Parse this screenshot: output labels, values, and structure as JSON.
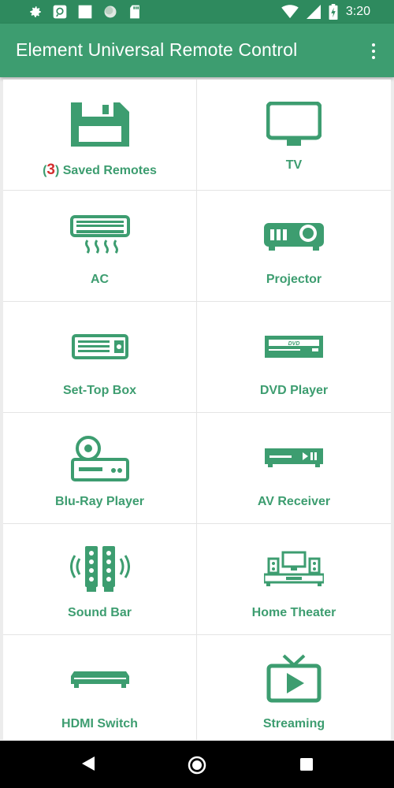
{
  "status_bar": {
    "time": "3:20",
    "left_icons": [
      "gear-icon",
      "cast-icon",
      "square-icon",
      "circle-icon",
      "sd-card-icon"
    ],
    "right_icons": [
      "wifi-icon",
      "signal-icon",
      "battery-icon"
    ]
  },
  "app_bar": {
    "title": "Element Universal Remote Control",
    "menu_icon": "overflow-menu-icon"
  },
  "tiles": [
    {
      "label": "Saved Remotes",
      "count": "3",
      "icon": "floppy-disk-icon"
    },
    {
      "label": "TV",
      "icon": "tv-icon"
    },
    {
      "label": "AC",
      "icon": "air-conditioner-icon"
    },
    {
      "label": "Projector",
      "icon": "projector-icon"
    },
    {
      "label": "Set-Top Box",
      "icon": "set-top-box-icon"
    },
    {
      "label": "DVD Player",
      "icon": "dvd-player-icon",
      "icon_text": "DVD"
    },
    {
      "label": "Blu-Ray Player",
      "icon": "bluray-player-icon"
    },
    {
      "label": "AV Receiver",
      "icon": "av-receiver-icon"
    },
    {
      "label": "Sound Bar",
      "icon": "sound-bar-icon"
    },
    {
      "label": "Home Theater",
      "icon": "home-theater-icon"
    },
    {
      "label": "HDMI Switch",
      "icon": "hdmi-switch-icon"
    },
    {
      "label": "Streaming",
      "icon": "streaming-icon"
    }
  ],
  "nav_bar": {
    "buttons": [
      "back-icon",
      "home-icon",
      "recents-icon"
    ]
  },
  "colors": {
    "status_bar": "#2e8a5e",
    "app_bar": "#3d9d70",
    "accent": "#3d9d70",
    "count": "#d32f2f"
  }
}
